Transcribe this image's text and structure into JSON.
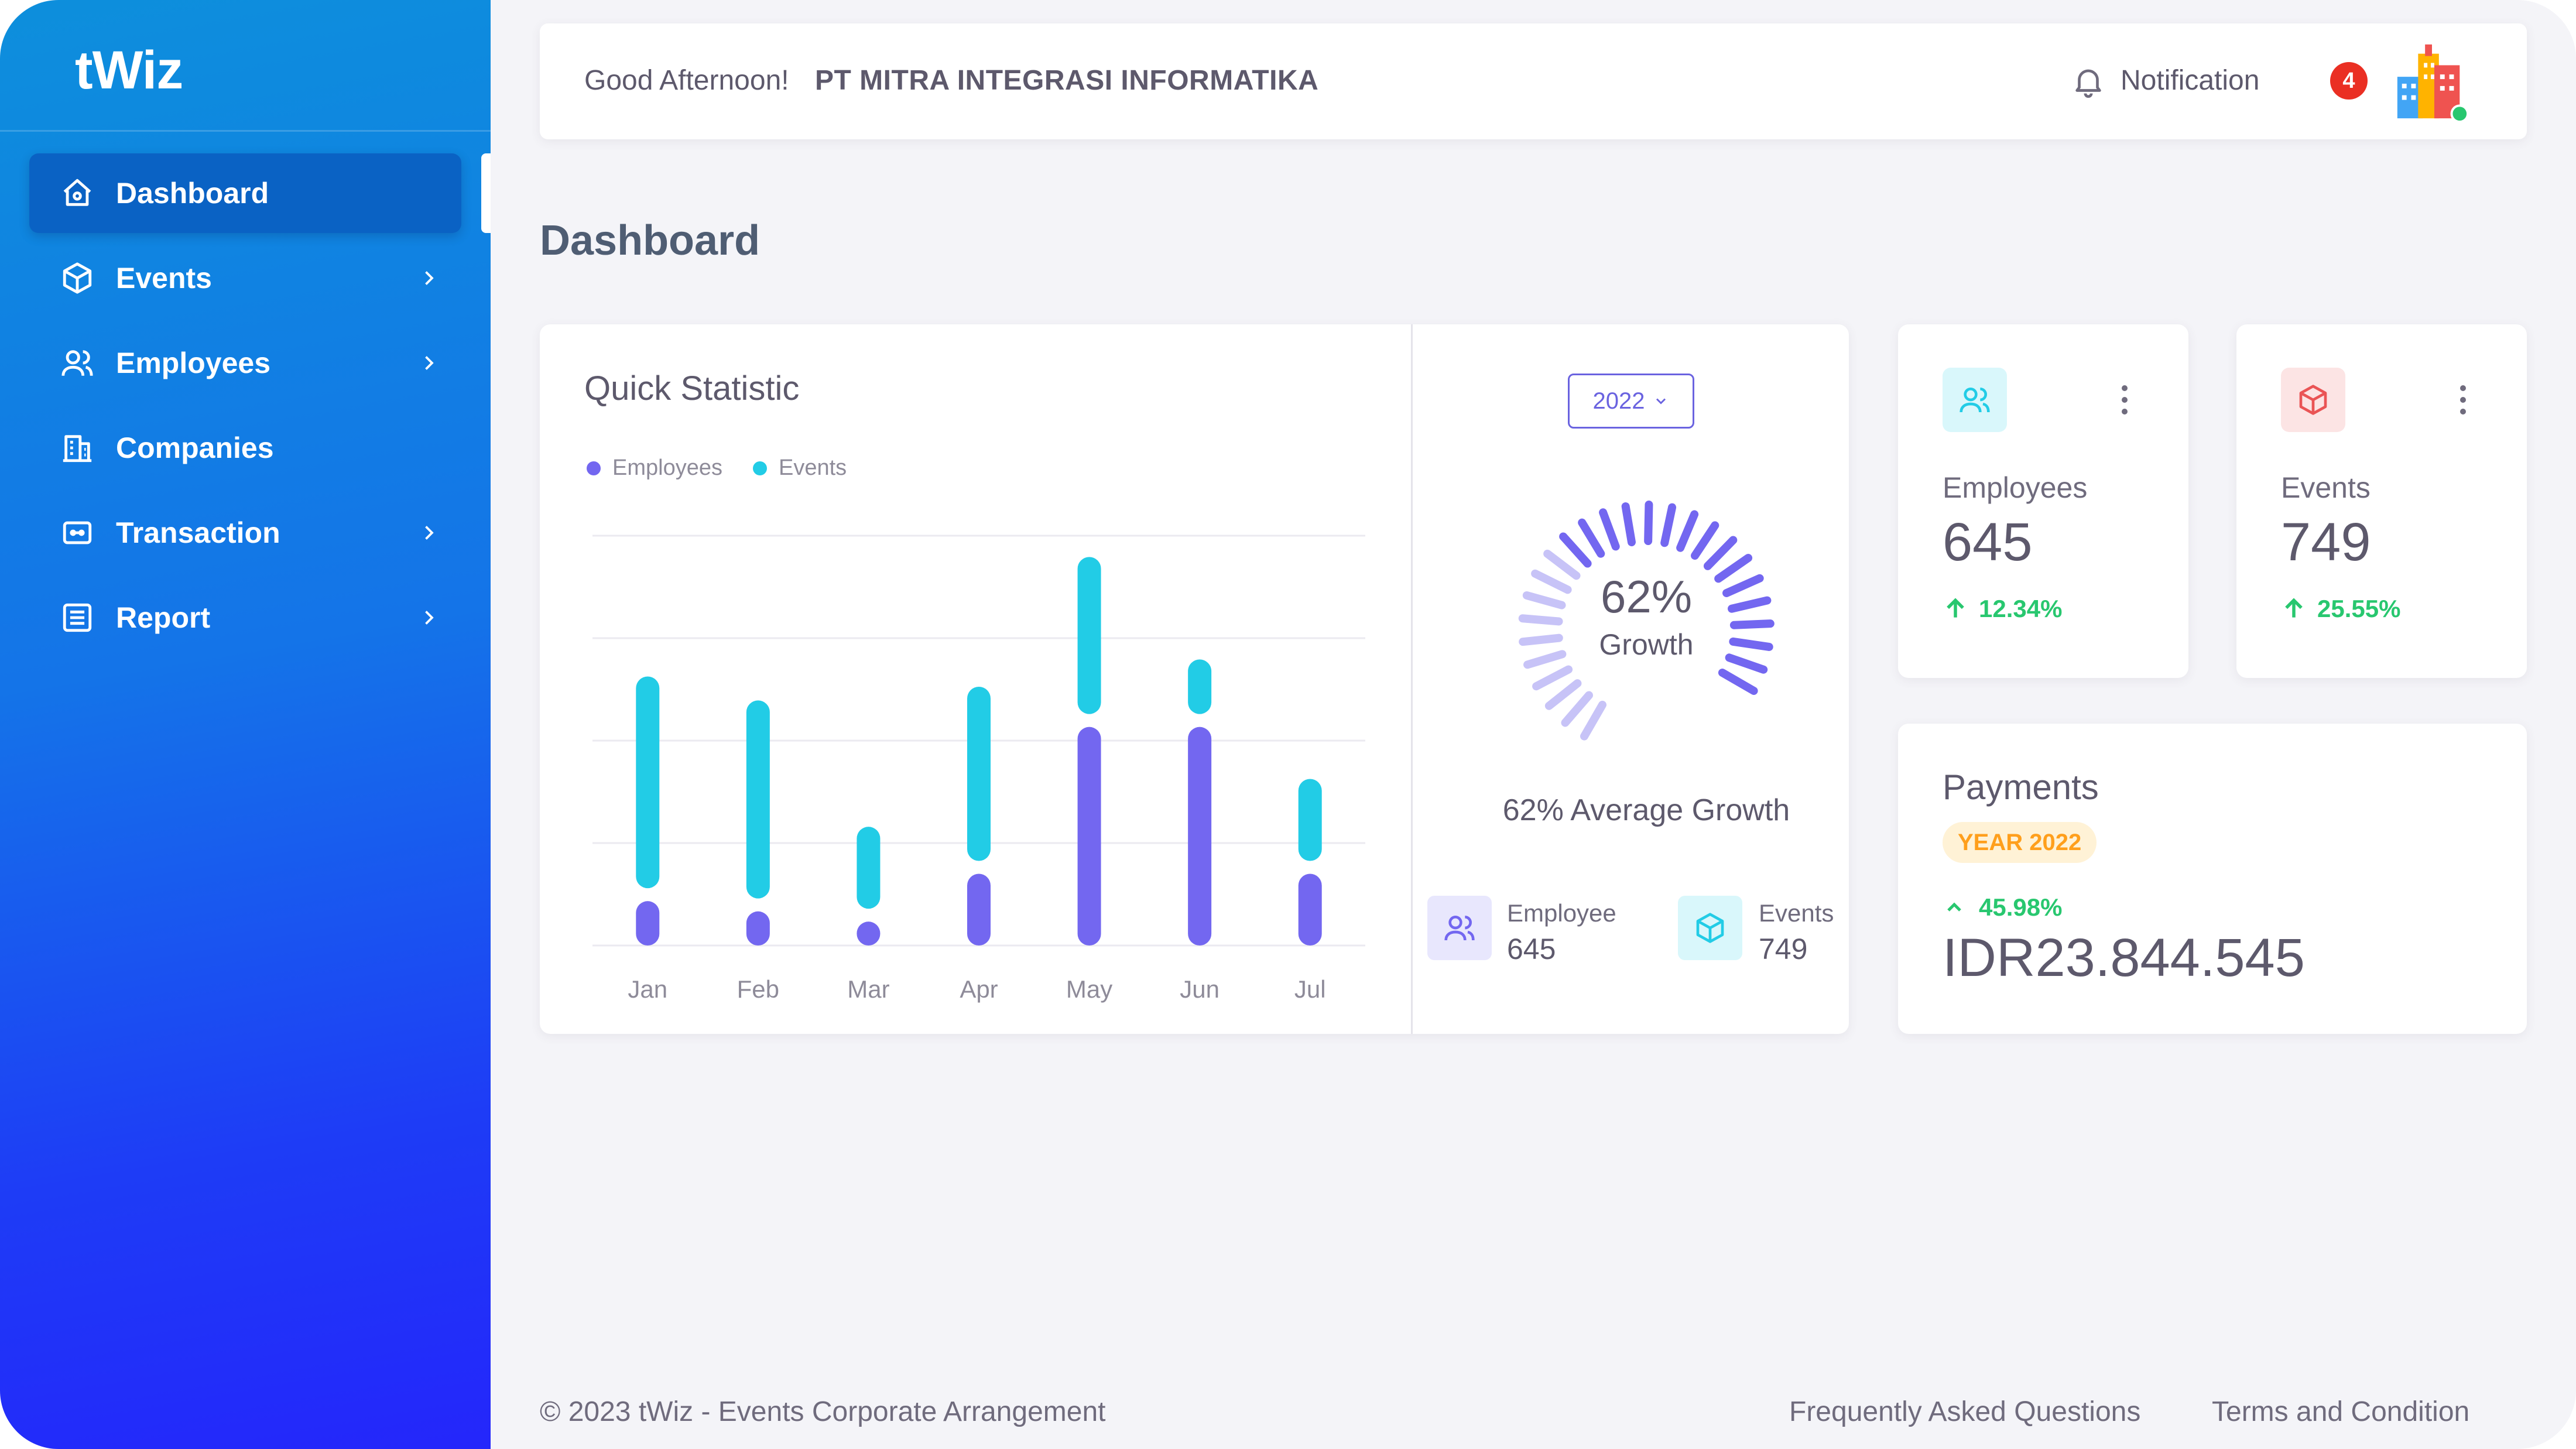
{
  "app": {
    "brand": "tWiz"
  },
  "sidebar": {
    "items": [
      {
        "label": "Dashboard",
        "icon": "home-icon",
        "active": true,
        "has_submenu": false
      },
      {
        "label": "Events",
        "icon": "box-icon",
        "active": false,
        "has_submenu": true
      },
      {
        "label": "Employees",
        "icon": "users-icon",
        "active": false,
        "has_submenu": true
      },
      {
        "label": "Companies",
        "icon": "building-icon",
        "active": false,
        "has_submenu": false
      },
      {
        "label": "Transaction",
        "icon": "wallet-icon",
        "active": false,
        "has_submenu": true
      },
      {
        "label": "Report",
        "icon": "report-icon",
        "active": false,
        "has_submenu": true
      }
    ]
  },
  "header": {
    "greeting": "Good Afternoon!",
    "company": "PT MITRA INTEGRASI INFORMATIKA",
    "notification_label": "Notification",
    "notification_count": "4",
    "avatar_icon": "company-logo-icon"
  },
  "page": {
    "title": "Dashboard"
  },
  "quick_statistic": {
    "title": "Quick Statistic",
    "year_select": "2022",
    "growth_percent": "62%",
    "growth_label": "Growth",
    "average_growth": "62% Average Growth",
    "summary": [
      {
        "label": "Employee",
        "value": "645"
      },
      {
        "label": "Events",
        "value": "749"
      }
    ]
  },
  "chart_data": {
    "type": "bar",
    "stacked": true,
    "categories": [
      "Jan",
      "Feb",
      "Mar",
      "Apr",
      "May",
      "Jun",
      "Jul"
    ],
    "series": [
      {
        "name": "Employees",
        "color": "#7367f0",
        "values": [
          13,
          10,
          7,
          21,
          64,
          64,
          21
        ]
      },
      {
        "name": "Events",
        "color": "#22cce6",
        "values": [
          62,
          58,
          24,
          51,
          46,
          16,
          24
        ]
      }
    ],
    "ylim": [
      0,
      120
    ],
    "grid": true,
    "legend_position": "top-left"
  },
  "gauge": {
    "value": 0.62,
    "color": "#7367f0"
  },
  "stats": [
    {
      "label": "Employees",
      "value": "645",
      "delta": "12.34%",
      "icon": "users-icon",
      "accent": "#22cce6",
      "accent_bg": "#d9f7fb"
    },
    {
      "label": "Events",
      "value": "749",
      "delta": "25.55%",
      "icon": "box-icon",
      "accent": "#ea5455",
      "accent_bg": "#fce4e4"
    }
  ],
  "payments": {
    "title": "Payments",
    "badge": "YEAR 2022",
    "delta": "45.98%",
    "amount": "IDR23.844.545"
  },
  "footer": {
    "copyright": "© 2023 tWiz - Events Corporate Arrangement",
    "links": [
      "Frequently Asked Questions",
      "Terms and Condition"
    ]
  }
}
